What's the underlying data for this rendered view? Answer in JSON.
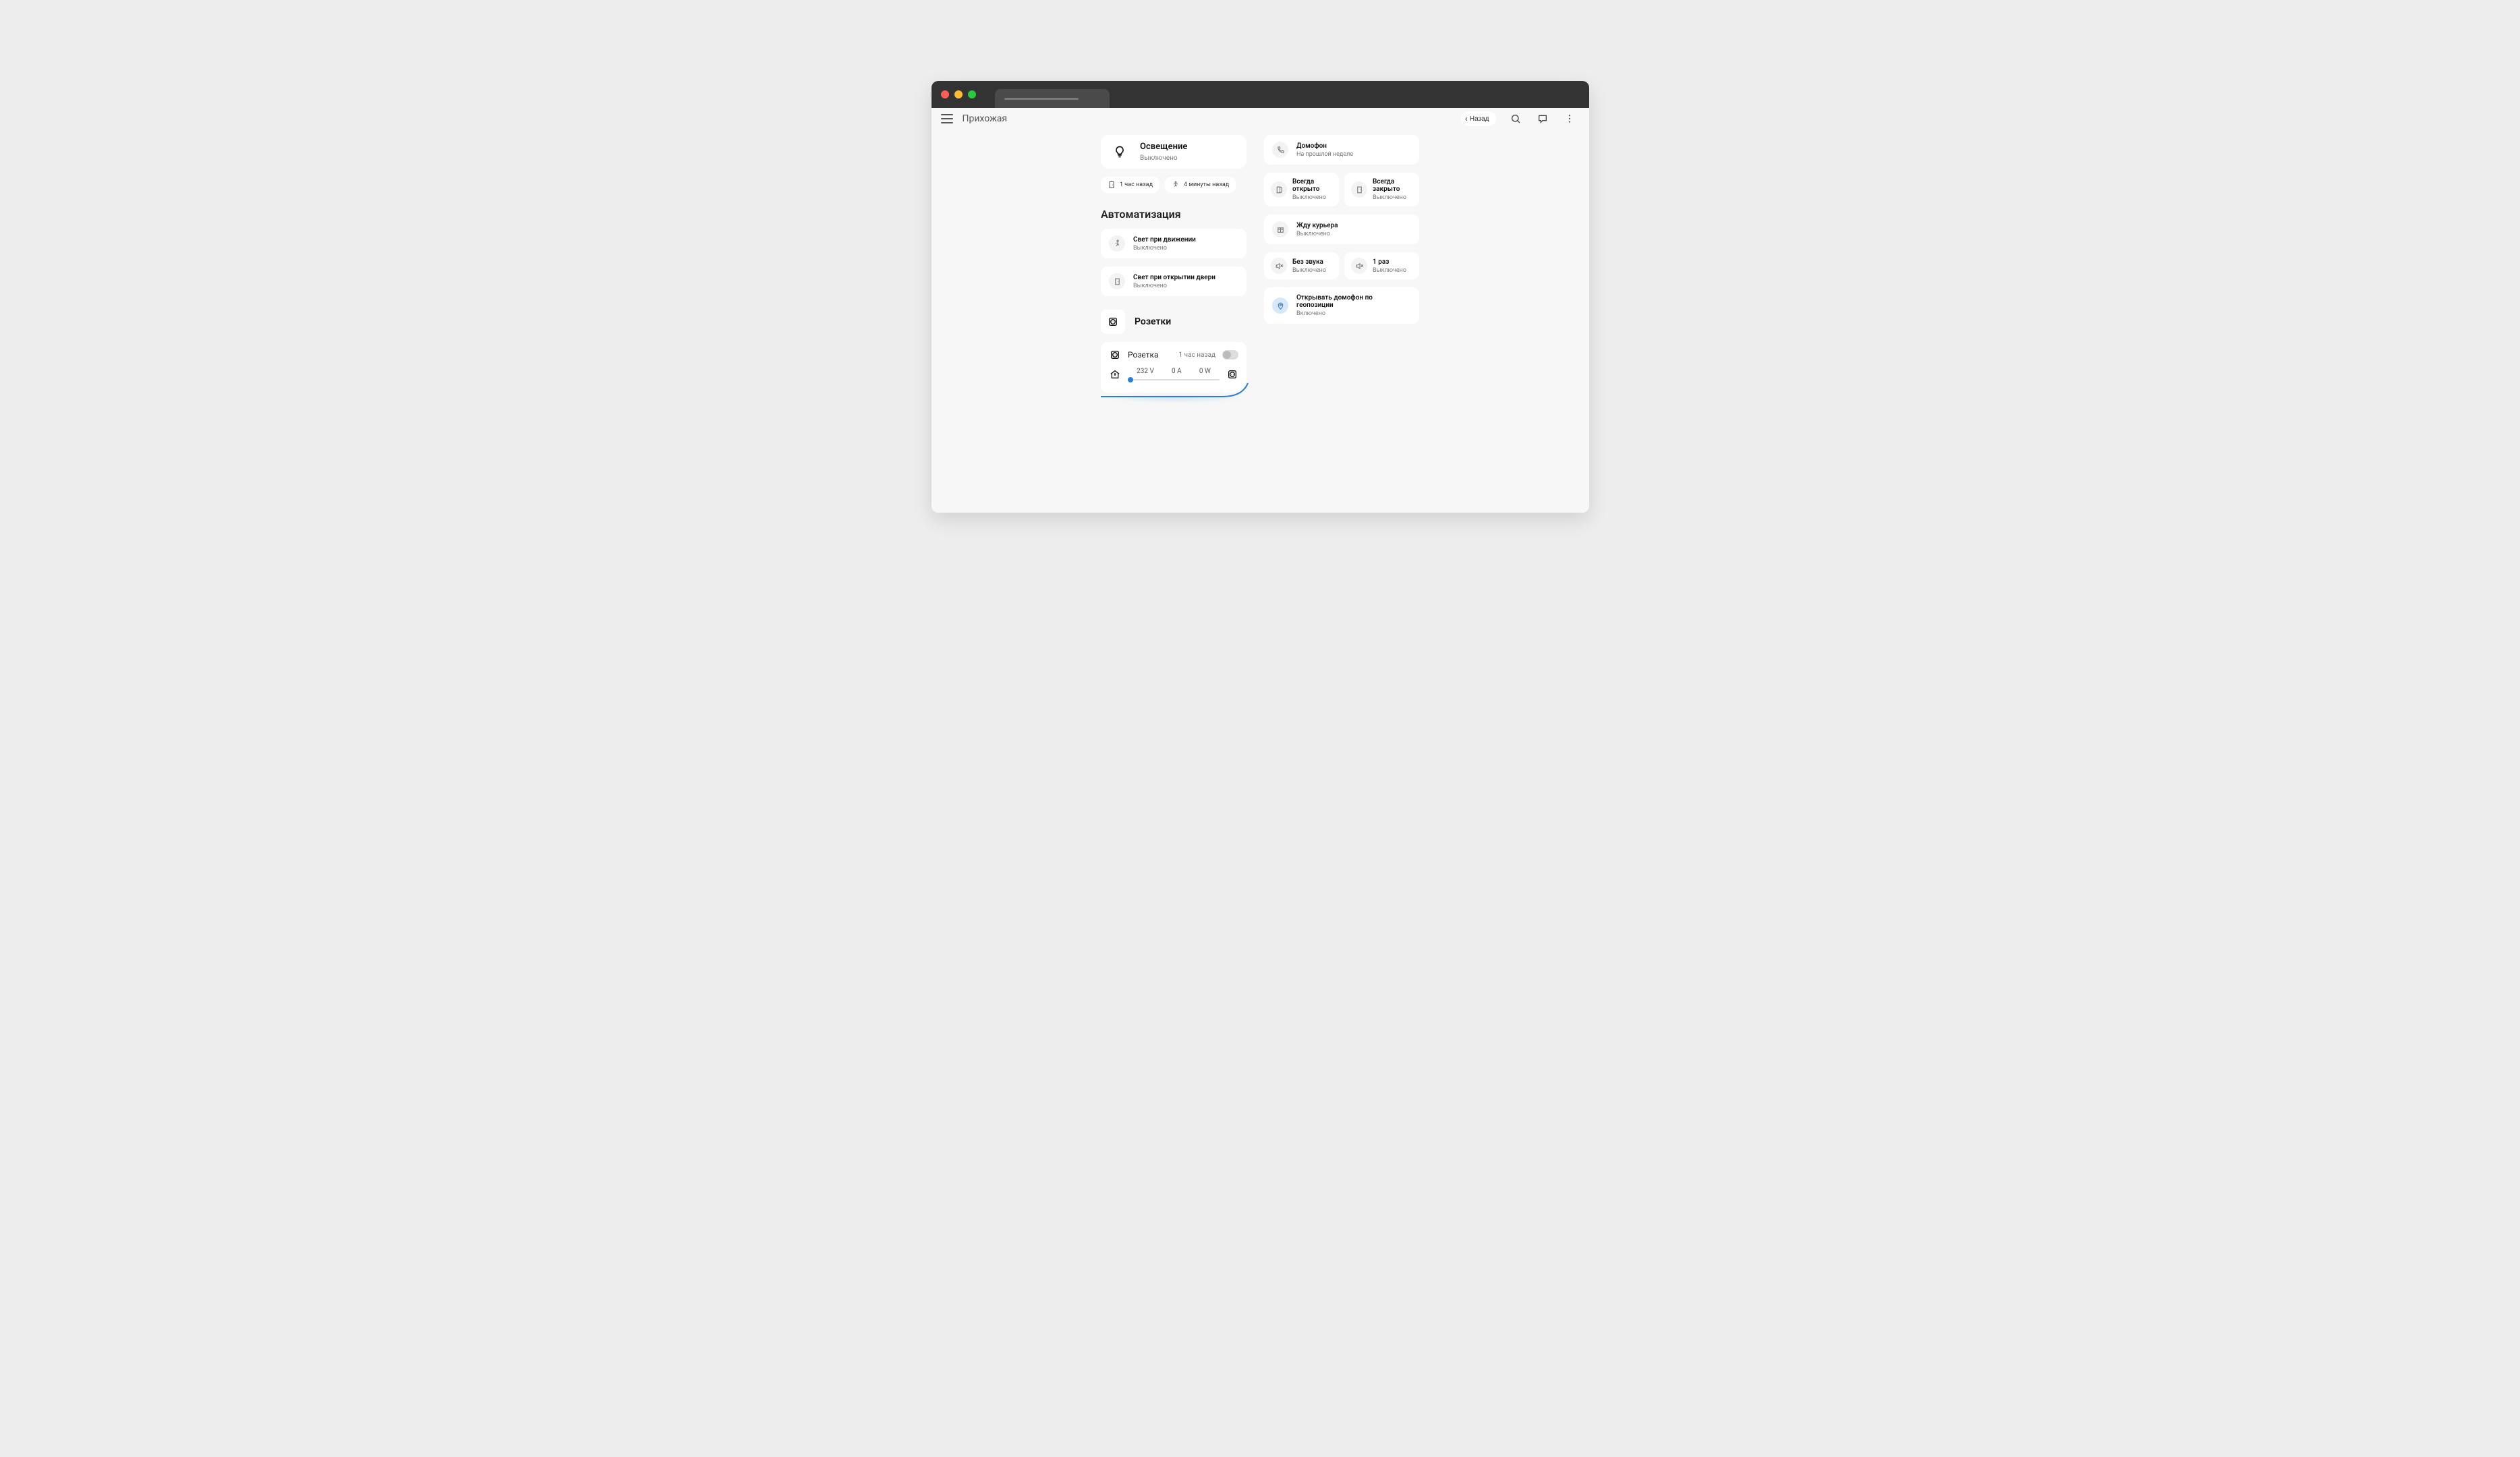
{
  "header": {
    "title": "Прихожая",
    "back_label": "Назад"
  },
  "lighting": {
    "title": "Освещение",
    "status": "Выключено",
    "chips": {
      "door": "1 час назад",
      "motion": "4 минуты назад"
    }
  },
  "automation": {
    "section_title": "Автоматизация",
    "items": [
      {
        "title": "Свет при движении",
        "status": "Выключено",
        "icon": "walk"
      },
      {
        "title": "Свет при открытии двери",
        "status": "Выключено",
        "icon": "door"
      }
    ]
  },
  "sockets": {
    "section_title": "Розетки",
    "socket": {
      "name": "Розетка",
      "last": "1 час назад",
      "metrics": {
        "voltage": "232 V",
        "current": "0 A",
        "power": "0 W"
      }
    }
  },
  "intercom": {
    "device": {
      "title": "Домофон",
      "status": "На прошлой неделе"
    },
    "always_open": {
      "title": "Всегда открыто",
      "status": "Выключено"
    },
    "always_closed": {
      "title": "Всегда закрыто",
      "status": "Выключено"
    },
    "wait_courier": {
      "title": "Жду курьера",
      "status": "Выключено"
    },
    "mute": {
      "title": "Без звука",
      "status": "Выключено"
    },
    "once": {
      "title": "1 раз",
      "status": "Выключено"
    },
    "geo_open": {
      "title": "Открывать домофон по геопозиции",
      "status": "Включено"
    }
  }
}
